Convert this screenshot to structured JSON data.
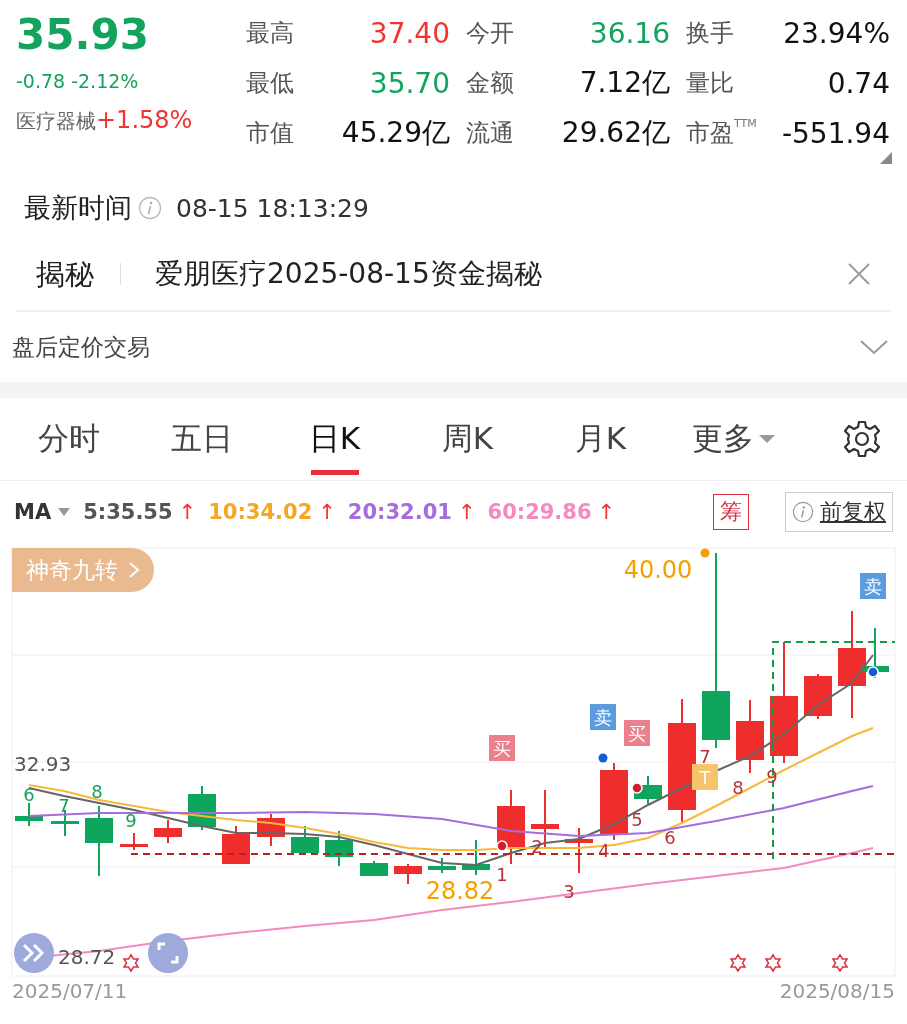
{
  "quote": {
    "price": "35.93",
    "change": "-0.78",
    "change_pct": "-2.12%",
    "sector": {
      "name": "医疗器械",
      "change": "+1.58%"
    }
  },
  "stats": [
    {
      "label": "最高",
      "value": "37.40",
      "color": "#f03333"
    },
    {
      "label": "今开",
      "value": "36.16",
      "color": "#12a35d"
    },
    {
      "label": "换手",
      "value": "23.94%",
      "color": "#111111"
    },
    {
      "label": "最低",
      "value": "35.70",
      "color": "#12a35d"
    },
    {
      "label": "金额",
      "value": "7.12亿",
      "color": "#111111"
    },
    {
      "label": "量比",
      "value": "0.74",
      "color": "#111111"
    },
    {
      "label": "市值",
      "value": "45.29亿",
      "color": "#111111"
    },
    {
      "label": "流通",
      "value": "29.62亿",
      "color": "#111111"
    },
    {
      "label": "市盈$^{TTM}$",
      "value": "-551.94",
      "color": "#111111"
    }
  ],
  "latest_time": {
    "label": "最新时间",
    "value": "08-15 18:13:29"
  },
  "reveal": {
    "tag": "揭秘",
    "text": "爱朋医疗2025-08-15资金揭秘"
  },
  "after_hours": {
    "label": "盘后定价交易",
    "expanded": false
  },
  "tabs": [
    {
      "label": "分时",
      "selected": false,
      "dropdown": false
    },
    {
      "label": "五日",
      "selected": false,
      "dropdown": false
    },
    {
      "label": "日K",
      "selected": true,
      "dropdown": false
    },
    {
      "label": "周K",
      "selected": false,
      "dropdown": false
    },
    {
      "label": "月K",
      "selected": false,
      "dropdown": false
    },
    {
      "label": "更多",
      "selected": false,
      "dropdown": true
    }
  ],
  "ma_legend": {
    "label": "MA",
    "items": [
      {
        "text": "5:35.55",
        "arrow": "↑",
        "color": "#555555"
      },
      {
        "text": "10:34.02",
        "arrow": "↑",
        "color": "#f5a623"
      },
      {
        "text": "20:32.01",
        "arrow": "↑",
        "color": "#a66bdc"
      },
      {
        "text": "60:29.86",
        "arrow": "↑",
        "color": "#f58ac0"
      }
    ],
    "chips_button": "筹",
    "adjust_button": "前复权"
  },
  "chart": {
    "badge": "神奇九转",
    "y_labels": [
      "32.93",
      "28.72"
    ],
    "x_labels": [
      "2025/07/11",
      "2025/08/15"
    ],
    "markers": [
      {
        "kind": "count_down",
        "text": "6"
      },
      {
        "kind": "count_down",
        "text": "7"
      },
      {
        "kind": "count_down",
        "text": "8"
      },
      {
        "kind": "count_down",
        "text": "9"
      },
      {
        "kind": "count_up",
        "text": "1"
      },
      {
        "kind": "count_up",
        "text": "2"
      },
      {
        "kind": "count_up",
        "text": "3"
      },
      {
        "kind": "count_up",
        "text": "4"
      },
      {
        "kind": "count_up",
        "text": "5"
      },
      {
        "kind": "count_up",
        "text": "6"
      },
      {
        "kind": "count_up",
        "text": "7"
      },
      {
        "kind": "count_up",
        "text": "8"
      },
      {
        "kind": "count_up",
        "text": "9"
      },
      {
        "kind": "buy",
        "text": "买"
      },
      {
        "kind": "sell",
        "text": "卖"
      },
      {
        "kind": "buy",
        "text": "买"
      },
      {
        "kind": "sell",
        "text": "卖"
      },
      {
        "kind": "t",
        "text": "T"
      },
      {
        "kind": "price",
        "text": "40.00"
      },
      {
        "kind": "price",
        "text": "28.82"
      }
    ]
  }
}
